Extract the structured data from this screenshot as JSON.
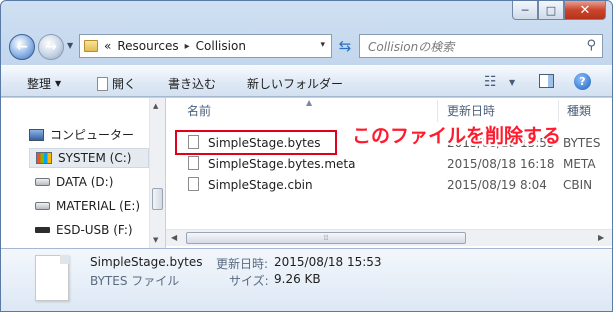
{
  "window": {
    "caption": {
      "minimize_glyph": "─",
      "maximize_glyph": "□",
      "close_glyph": "✕"
    }
  },
  "address_bar": {
    "overflow_glyph": "«",
    "path": [
      "Resources",
      "Collision"
    ],
    "separator_glyph": "▸",
    "dropdown_glyph": "▾"
  },
  "search": {
    "placeholder": "Collisionの検索",
    "icon": "search-icon"
  },
  "toolbar": {
    "organize": "整理",
    "open": "開く",
    "burn": "書き込む",
    "new_folder": "新しいフォルダー",
    "help_glyph": "?"
  },
  "navigation": {
    "computer": "コンピューター",
    "drives": [
      {
        "label": "SYSTEM (C:)",
        "icon": "system-drive-icon",
        "selected": true
      },
      {
        "label": "DATA (D:)",
        "icon": "drive-icon",
        "selected": false
      },
      {
        "label": "MATERIAL (E:)",
        "icon": "drive-icon",
        "selected": false
      },
      {
        "label": "ESD-USB (F:)",
        "icon": "usb-drive-icon",
        "selected": false
      }
    ]
  },
  "file_list": {
    "columns": {
      "name": "名前",
      "date": "更新日時",
      "type": "種類"
    },
    "files": [
      {
        "name": "SimpleStage.bytes",
        "date": "2015/08/18 15:53",
        "type": "BYTES"
      },
      {
        "name": "SimpleStage.bytes.meta",
        "date": "2015/08/18 16:18",
        "type": "META"
      },
      {
        "name": "SimpleStage.cbin",
        "date": "2015/08/19 8:04",
        "type": "CBIN"
      }
    ],
    "callout": "このファイルを削除する",
    "highlight_color": "#e0001a"
  },
  "details": {
    "file_name": "SimpleStage.bytes",
    "modified_label": "更新日時:",
    "modified_value": "2015/08/18 15:53",
    "file_type": "BYTES ファイル",
    "size_label": "サイズ:",
    "size_value": "9.26 KB"
  }
}
